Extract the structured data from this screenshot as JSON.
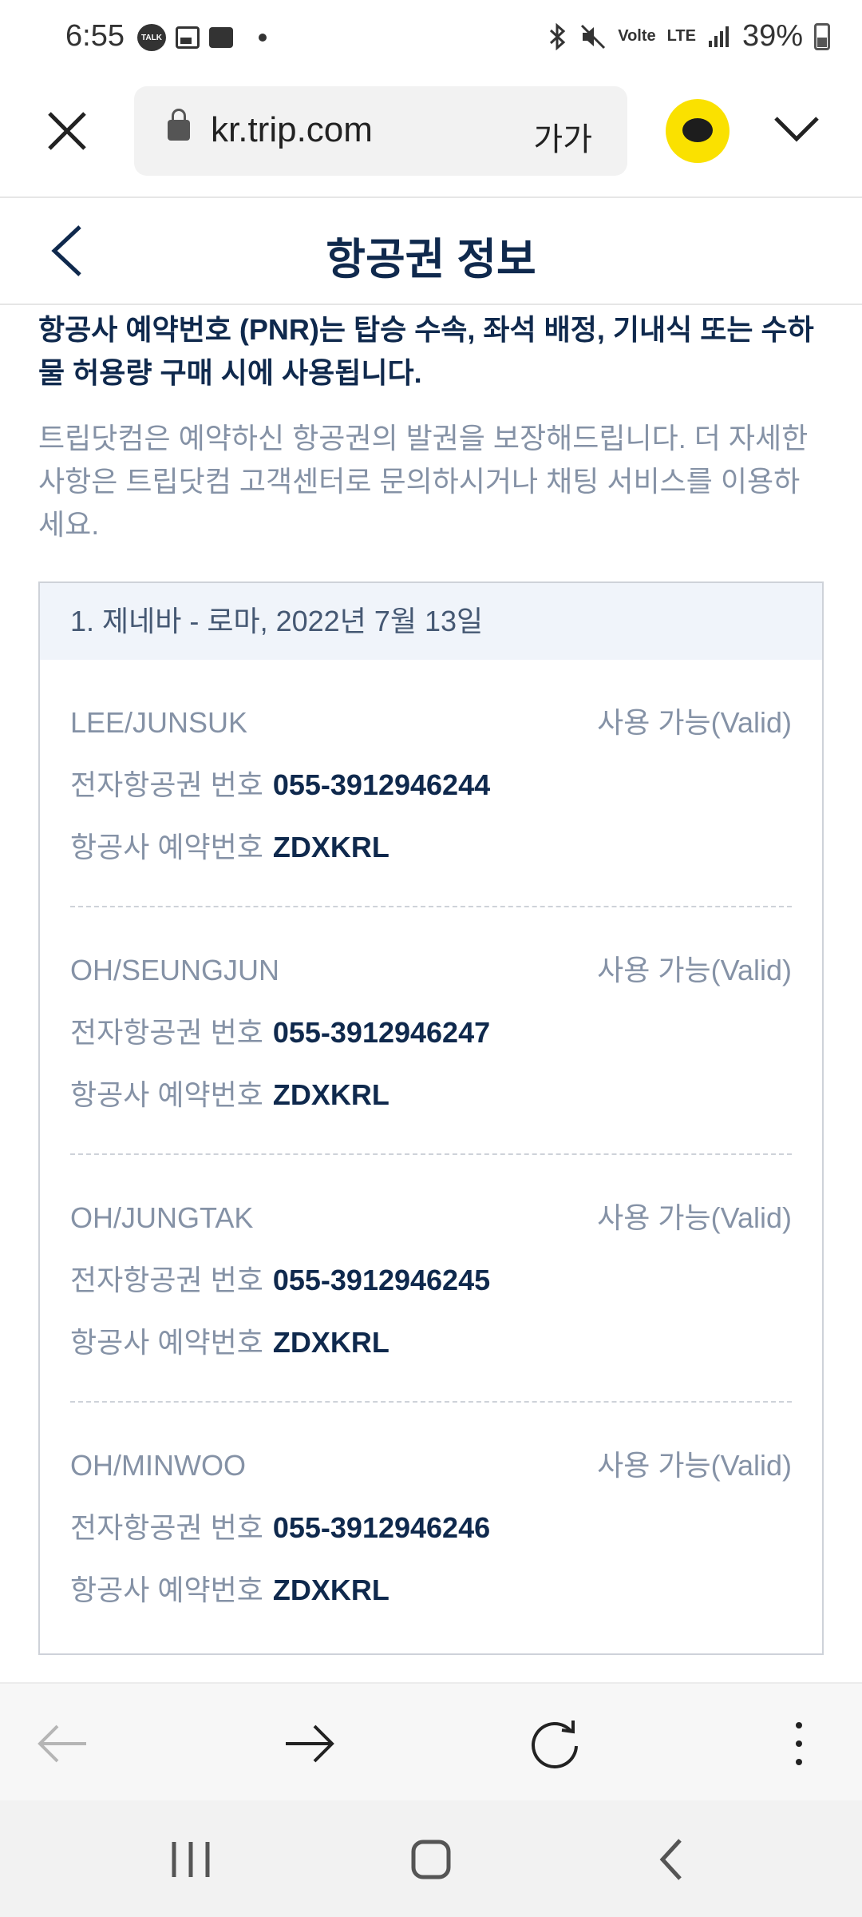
{
  "status_bar": {
    "time": "6:55",
    "talk_badge": "TALK",
    "network": "LTE",
    "volte": "Volte",
    "battery": "39%"
  },
  "browser": {
    "url": "kr.trip.com",
    "text_size_label": "가가"
  },
  "page": {
    "title": "항공권 정보"
  },
  "notice": {
    "bold_text": "항공사 예약번호 (PNR)는 탑승 수속, 좌석 배정, 기내식 또는 수하물 허용량 구매 시에 사용됩니다.",
    "gray_text": "트립닷컴은 예약하신 항공권의 발권을 보장해드립니다. 더 자세한 사항은 트립닷컴 고객센터로 문의하시거나 채팅 서비스를 이용하세요."
  },
  "flight": {
    "header": "1. 제네바 - 로마, 2022년 7월 13일",
    "ticket_label": "전자항공권 번호",
    "pnr_label": "항공사 예약번호",
    "passengers": [
      {
        "name": "LEE/JUNSUK",
        "status": "사용 가능(Valid)",
        "ticket": "055-3912946244",
        "pnr": "ZDXKRL"
      },
      {
        "name": "OH/SEUNGJUN",
        "status": "사용 가능(Valid)",
        "ticket": "055-3912946247",
        "pnr": "ZDXKRL"
      },
      {
        "name": "OH/JUNGTAK",
        "status": "사용 가능(Valid)",
        "ticket": "055-3912946245",
        "pnr": "ZDXKRL"
      },
      {
        "name": "OH/MINWOO",
        "status": "사용 가능(Valid)",
        "ticket": "055-3912946246",
        "pnr": "ZDXKRL"
      }
    ]
  },
  "colors": {
    "title": "#0f294d",
    "muted": "#8592a6",
    "kakao": "#fae100"
  }
}
